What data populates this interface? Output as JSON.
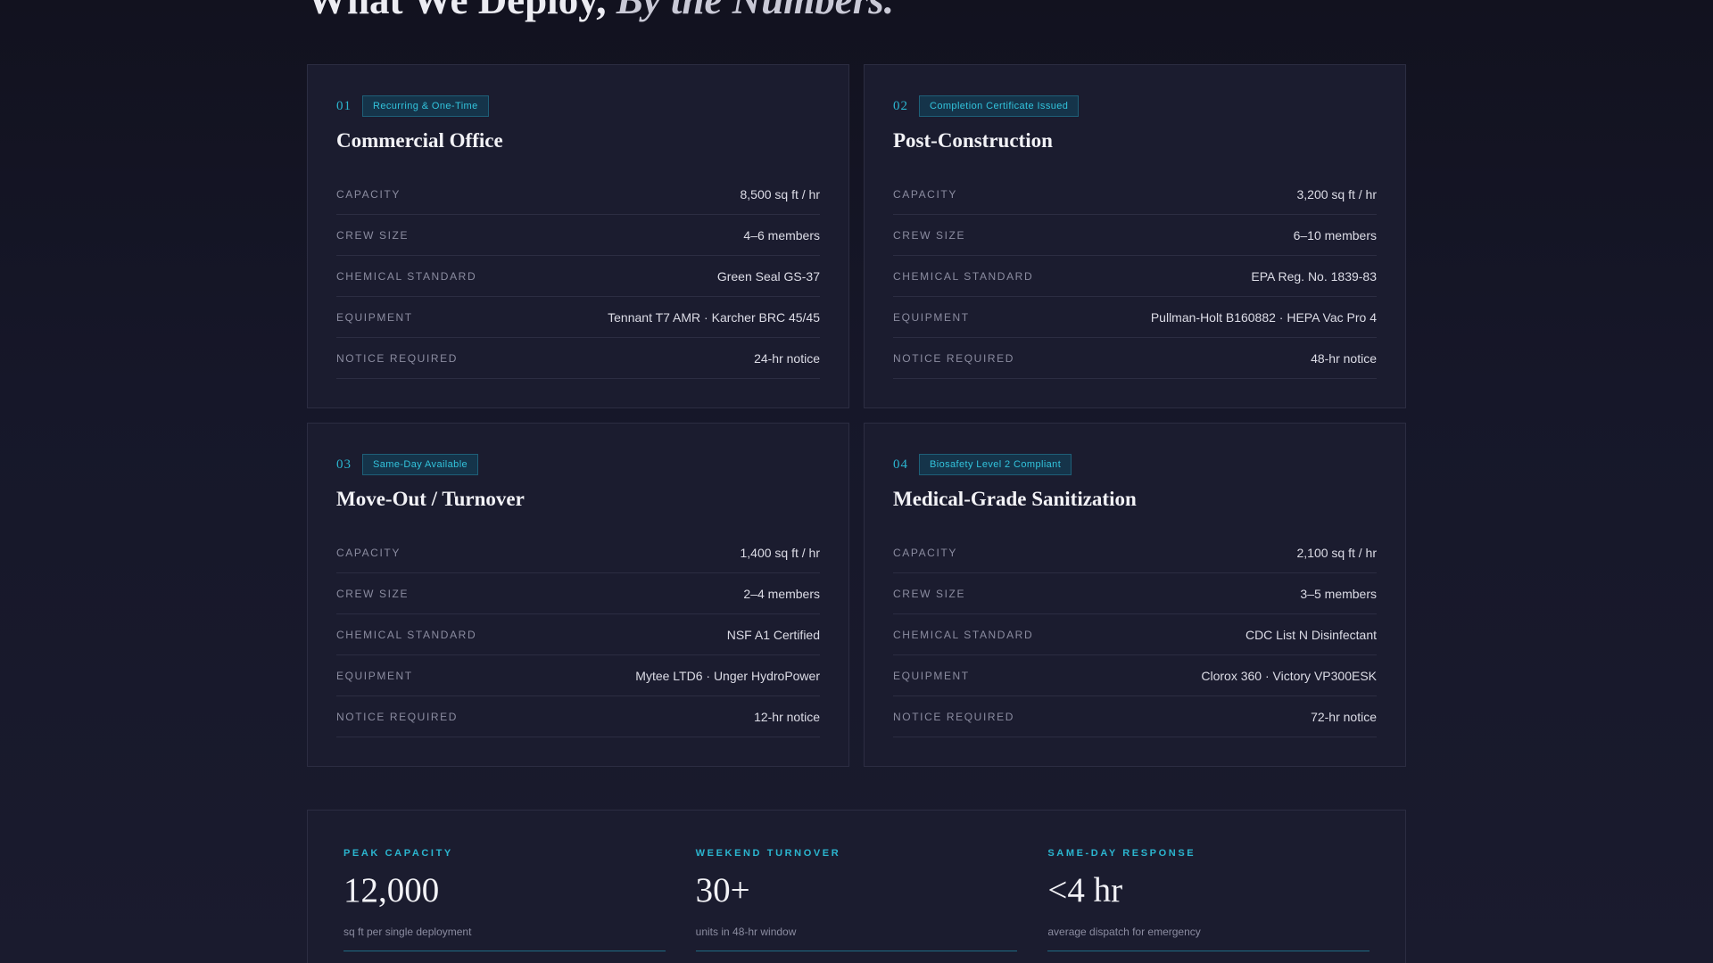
{
  "section": {
    "title_plain": "What We Deploy,",
    "title_italic": "By the Numbers."
  },
  "services": [
    {
      "number": "01",
      "badge": "Recurring & One-Time",
      "title": "Commercial Office",
      "specs": [
        {
          "label": "CAPACITY",
          "value": "8,500 sq ft / hr"
        },
        {
          "label": "CREW SIZE",
          "value": "4–6 members"
        },
        {
          "label": "CHEMICAL STANDARD",
          "value": "Green Seal GS-37"
        },
        {
          "label": "EQUIPMENT",
          "value": "Tennant T7 AMR · Karcher BRC 45/45"
        },
        {
          "label": "NOTICE REQUIRED",
          "value": "24-hr notice"
        }
      ]
    },
    {
      "number": "02",
      "badge": "Completion Certificate Issued",
      "title": "Post-Construction",
      "specs": [
        {
          "label": "CAPACITY",
          "value": "3,200 sq ft / hr"
        },
        {
          "label": "CREW SIZE",
          "value": "6–10 members"
        },
        {
          "label": "CHEMICAL STANDARD",
          "value": "EPA Reg. No. 1839-83"
        },
        {
          "label": "EQUIPMENT",
          "value": "Pullman-Holt B160882 · HEPA Vac Pro 4"
        },
        {
          "label": "NOTICE REQUIRED",
          "value": "48-hr notice"
        }
      ]
    },
    {
      "number": "03",
      "badge": "Same-Day Available",
      "title": "Move-Out / Turnover",
      "specs": [
        {
          "label": "CAPACITY",
          "value": "1,400 sq ft / hr"
        },
        {
          "label": "CREW SIZE",
          "value": "2–4 members"
        },
        {
          "label": "CHEMICAL STANDARD",
          "value": "NSF A1 Certified"
        },
        {
          "label": "EQUIPMENT",
          "value": "Mytee LTD6 · Unger HydroPower"
        },
        {
          "label": "NOTICE REQUIRED",
          "value": "12-hr notice"
        }
      ]
    },
    {
      "number": "04",
      "badge": "Biosafety Level 2 Compliant",
      "title": "Medical-Grade Sanitization",
      "specs": [
        {
          "label": "CAPACITY",
          "value": "2,100 sq ft / hr"
        },
        {
          "label": "CREW SIZE",
          "value": "3–5 members"
        },
        {
          "label": "CHEMICAL STANDARD",
          "value": "CDC List N Disinfectant"
        },
        {
          "label": "EQUIPMENT",
          "value": "Clorox 360 · Victory VP300ESK"
        },
        {
          "label": "NOTICE REQUIRED",
          "value": "72-hr notice"
        }
      ]
    }
  ],
  "stats": [
    {
      "label": "PEAK CAPACITY",
      "value": "12,000",
      "desc": "sq ft per single deployment"
    },
    {
      "label": "WEEKEND TURNOVER",
      "value": "30+",
      "desc": "units in 48-hr window"
    },
    {
      "label": "SAME-DAY RESPONSE",
      "value": "<4 hr",
      "desc": "average dispatch for emergency"
    }
  ],
  "colors": {
    "accent": "#2bb5cf",
    "background": "#161729",
    "card": "#1b1c2f"
  }
}
